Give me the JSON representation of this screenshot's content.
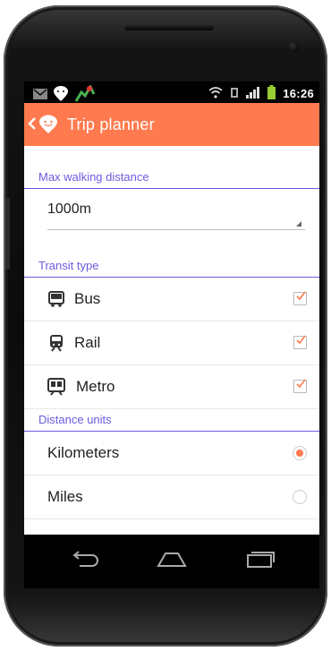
{
  "status_bar": {
    "time": "16:26"
  },
  "action_bar": {
    "title": "Trip planner"
  },
  "walking": {
    "header": "Max walking distance",
    "value": "1000m"
  },
  "transit": {
    "header": "Transit type",
    "items": [
      {
        "label": "Bus",
        "icon": "bus-icon",
        "checked": true
      },
      {
        "label": "Rail",
        "icon": "rail-icon",
        "checked": true
      },
      {
        "label": "Metro",
        "icon": "metro-icon",
        "checked": true
      }
    ]
  },
  "units": {
    "header": "Distance units",
    "items": [
      {
        "label": "Kilometers",
        "selected": true
      },
      {
        "label": "Miles",
        "selected": false
      }
    ]
  },
  "colors": {
    "accent": "#ff7a4e",
    "section": "#6a5be0"
  }
}
